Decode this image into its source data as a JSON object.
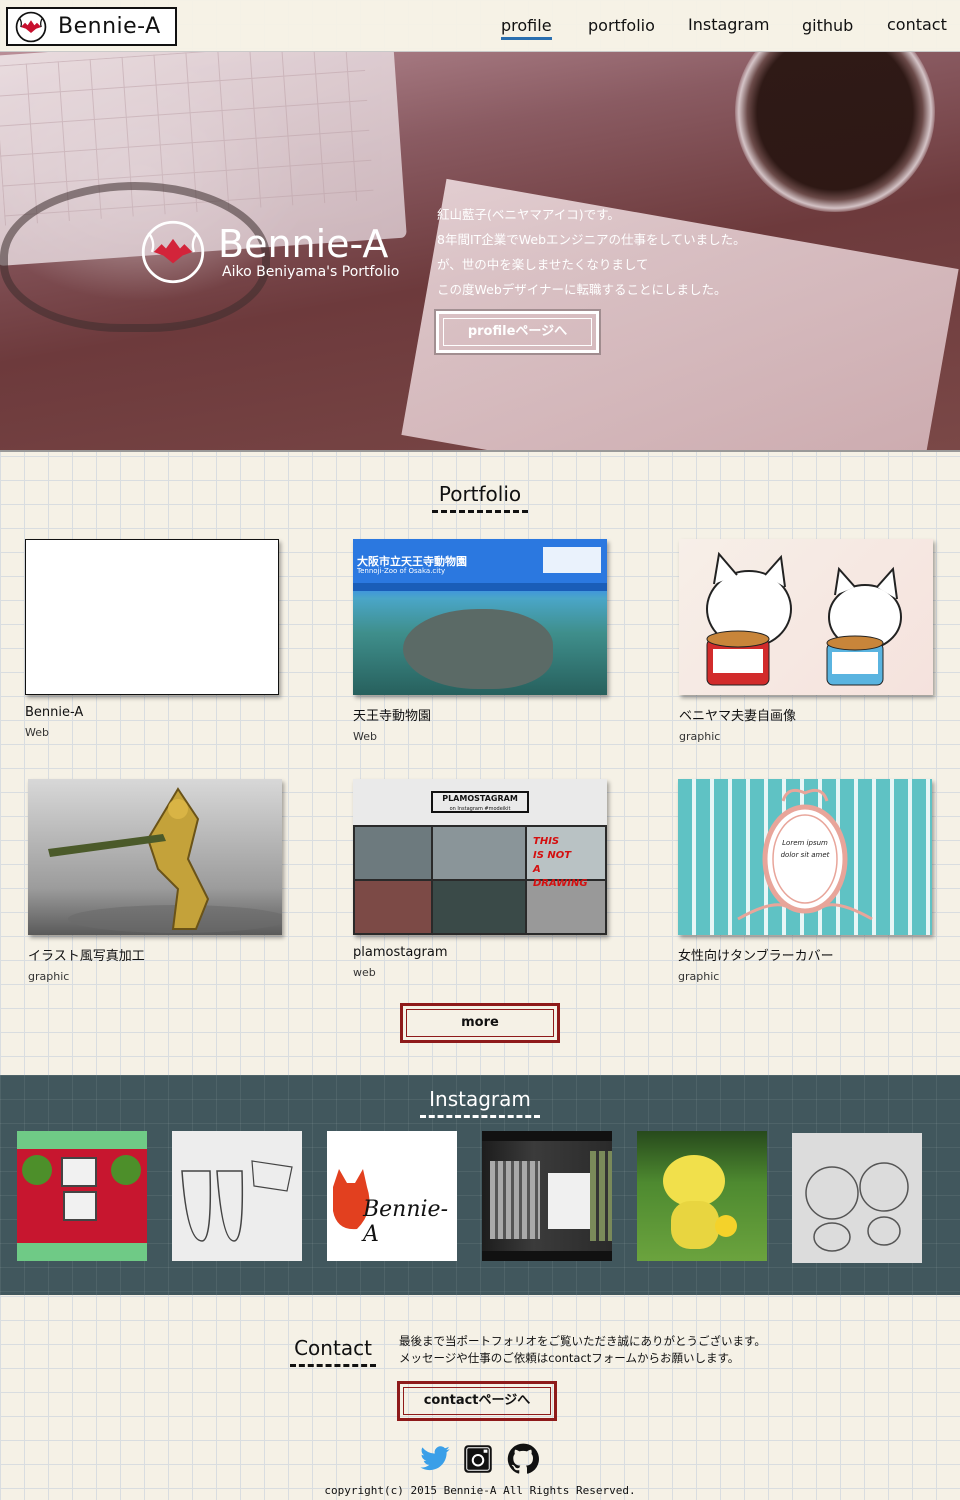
{
  "header": {
    "logo_text": "Bennie-A",
    "nav": [
      {
        "label": "profile"
      },
      {
        "label": "portfolio"
      },
      {
        "label": "Instagram"
      },
      {
        "label": "github"
      },
      {
        "label": "contact"
      }
    ],
    "active_nav": "profile",
    "active_color": "#2a6fb0"
  },
  "hero": {
    "brand_name": "Bennie-A",
    "brand_sub": "Aiko Beniyama's Portfolio",
    "intro_lines": [
      "紅山藍子(ベニヤマアイコ)です。",
      "8年間IT企業でWebエンジニアの仕事をしていました。",
      "が、世の中を楽しませたくなりまして",
      "この度Webデザイナーに転職することにしました。"
    ],
    "button_label": "profileページへ"
  },
  "portfolio": {
    "title": "Portfolio",
    "items": [
      {
        "title": "Bennie-A",
        "category": "Web"
      },
      {
        "title": "天王寺動物園",
        "category": "Web",
        "thumb_text": "大阪市立天王寺動物園",
        "thumb_sub": "Tennoji-Zoo of Osaka.city"
      },
      {
        "title": "ベニヤマ夫妻自画像",
        "category": "graphic"
      },
      {
        "title": "イラスト風写真加工",
        "category": "graphic"
      },
      {
        "title": "plamostagram",
        "category": "web",
        "thumb_text": "PLAMOSTAGRAM",
        "thumb_sub": "on Instagram #modeikit",
        "thumb_badge": "THIS IS NOT A DRAWING"
      },
      {
        "title": "女性向けタンブラーカバー",
        "category": "graphic",
        "thumb_text": "Lorem ipsum dolor sit amet"
      }
    ],
    "more_label": "more"
  },
  "instagram": {
    "title": "Instagram",
    "logo_text": "Bennie-A"
  },
  "contact": {
    "title": "Contact",
    "text_lines": [
      "最後まで当ポートフォリオをご覧いただき誠にありがとうございます。",
      "メッセージや仕事のご依頼はcontactフォームからお願いします。"
    ],
    "button_label": "contactページへ"
  },
  "social": [
    {
      "icon": "twitter-icon",
      "color": "#3a9fe8"
    },
    {
      "icon": "instagram-icon",
      "color": "#111111"
    },
    {
      "icon": "github-icon",
      "color": "#111111"
    }
  ],
  "footer": {
    "copyright": "copyright(c) 2015 Bennie-A All Rights Reserved."
  },
  "colors": {
    "accent_red": "#8e1a1a",
    "instagram_bg": "#41575d",
    "page_bg": "#f5f1e6"
  }
}
